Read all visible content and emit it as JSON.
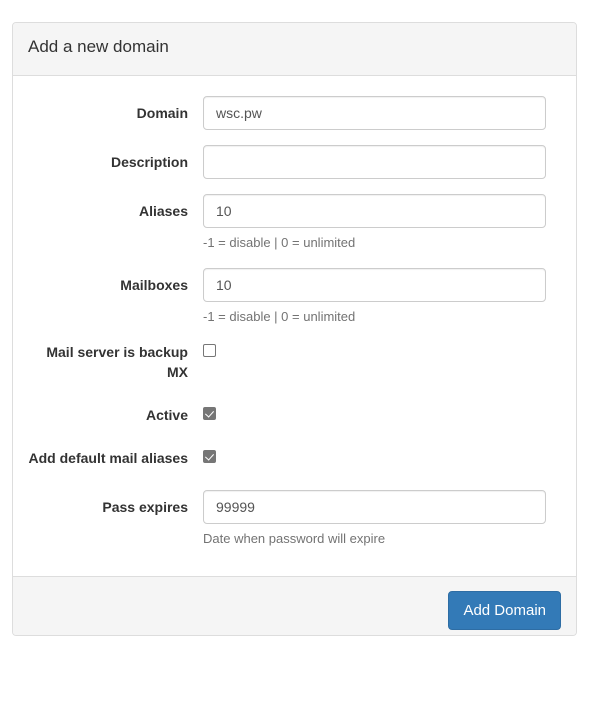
{
  "panel": {
    "title": "Add a new domain",
    "fields": [
      {
        "label": "Domain",
        "value": "wsc.pw",
        "placeholder": "",
        "help": ""
      },
      {
        "label": "Description",
        "value": "",
        "placeholder": "",
        "help": ""
      },
      {
        "label": "Aliases",
        "value": "10",
        "placeholder": "",
        "help": "-1 = disable | 0 = unlimited"
      },
      {
        "label": "Mailboxes",
        "value": "10",
        "placeholder": "",
        "help": "-1 = disable | 0 = unlimited"
      }
    ],
    "checkboxes": [
      {
        "label": "Mail server is backup MX",
        "checked": false
      },
      {
        "label": "Active",
        "checked": true
      },
      {
        "label": "Add default mail aliases",
        "checked": true
      }
    ],
    "pass_expires": {
      "label": "Pass expires",
      "value": "99999",
      "placeholder": "",
      "help": "Date when password will expire"
    },
    "footer": {
      "submit_label": "Add Domain"
    }
  },
  "colors": {
    "primary": "#337ab7",
    "primary_border": "#2e6da4",
    "panel_border": "#dddddd",
    "heading_bg": "#f5f5f5",
    "input_border": "#cccccc",
    "help_text": "#737373",
    "checkbox_fill": "#767676"
  }
}
